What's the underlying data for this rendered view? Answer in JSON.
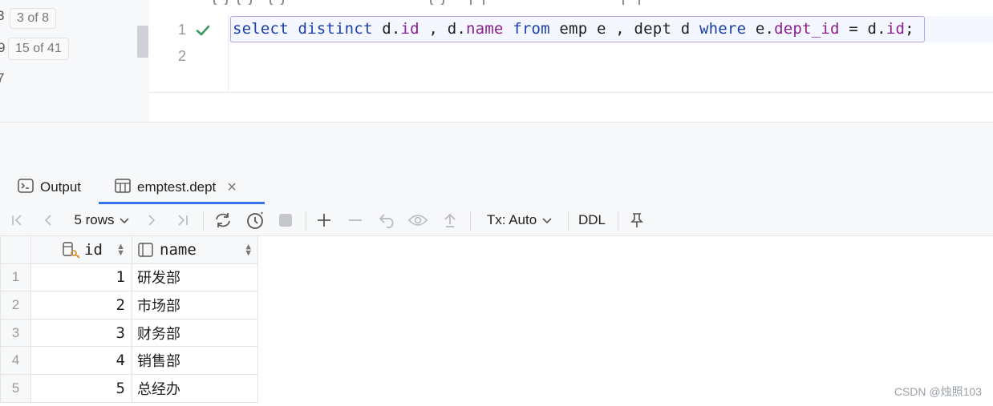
{
  "left_panel": {
    "partial_row_top": "3",
    "badge_top": "3 of 8",
    "partial_row_mid": "9",
    "badge_mid": "15 of 41",
    "partial_row_bottom": "7"
  },
  "editor": {
    "line_numbers": [
      "1",
      "2"
    ],
    "code": {
      "t1": "select",
      "t2": " ",
      "t3": "distinct",
      "t4": " d.",
      "t5": "id",
      "t6": " , d.",
      "t7": "name",
      "t8": " ",
      "t9": "from",
      "t10": " emp e , dept d ",
      "t11": "where",
      "t12": " e.",
      "t13": "dept_id",
      "t14": " = d.",
      "t15": "id",
      "t16": ";"
    }
  },
  "results_tabs": {
    "output_label": "Output",
    "table_tab_label": "emptest.dept",
    "close_glyph": "×"
  },
  "results_toolbar": {
    "rows_label": "5 rows",
    "tx_label": "Tx: Auto",
    "ddl_label": "DDL"
  },
  "grid": {
    "columns": [
      "id",
      "name"
    ],
    "rows": [
      {
        "n": "1",
        "id": "1",
        "name": "研发部"
      },
      {
        "n": "2",
        "id": "2",
        "name": "市场部"
      },
      {
        "n": "3",
        "id": "3",
        "name": "财务部"
      },
      {
        "n": "4",
        "id": "4",
        "name": "销售部"
      },
      {
        "n": "5",
        "id": "5",
        "name": "总经办"
      }
    ]
  },
  "watermark": "CSDN @烛照103",
  "colors": {
    "accent": "#3574f0",
    "keyword": "#1a3fa8",
    "field": "#8a1f8f",
    "check": "#3c9a5f"
  }
}
